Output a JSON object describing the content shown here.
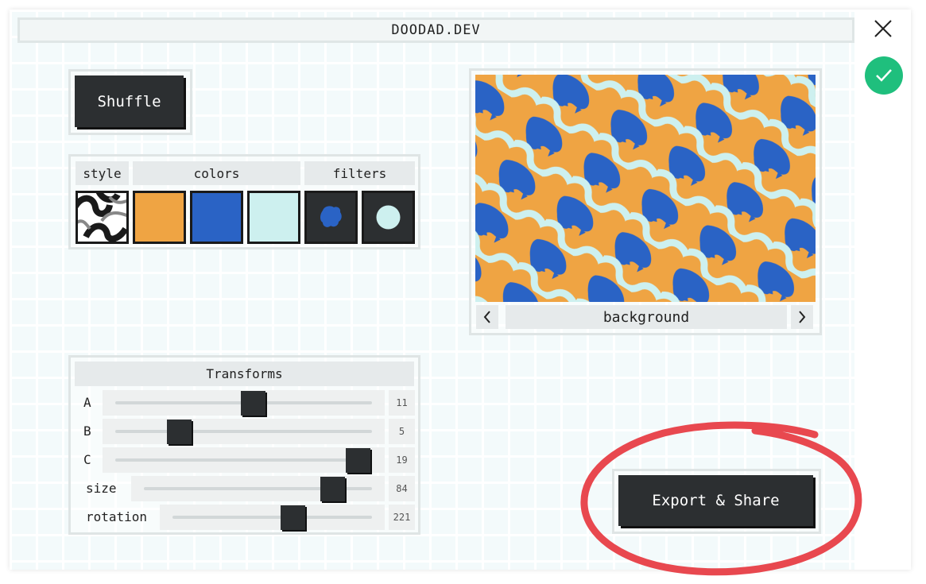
{
  "app": {
    "title": "DOODAD.DEV"
  },
  "toolbar": {
    "shuffle_label": "Shuffle"
  },
  "swatches": {
    "headers": {
      "style": "style",
      "colors": "colors",
      "filters": "filters"
    },
    "colors": [
      "#efa443",
      "#2a63c5",
      "#cdf0ef"
    ],
    "filter_bg": "#2c2f31"
  },
  "preview": {
    "layer_label": "background",
    "background_color": "#efa443",
    "shape_color": "#2a63c5",
    "line_color": "#cdf0ef"
  },
  "transforms": {
    "title": "Transforms",
    "sliders": [
      {
        "label": "A",
        "value": "11",
        "level": 0.54
      },
      {
        "label": "B",
        "value": "5",
        "level": 0.24
      },
      {
        "label": "C",
        "value": "19",
        "level": 0.96
      },
      {
        "label": "size",
        "value": "84",
        "level": 0.84
      },
      {
        "label": "rotation",
        "value": "221",
        "level": 0.61
      }
    ]
  },
  "export": {
    "label": "Export & Share"
  },
  "status": {
    "confirm_color": "#1fbf7d",
    "annotation_color": "#e8484f"
  }
}
